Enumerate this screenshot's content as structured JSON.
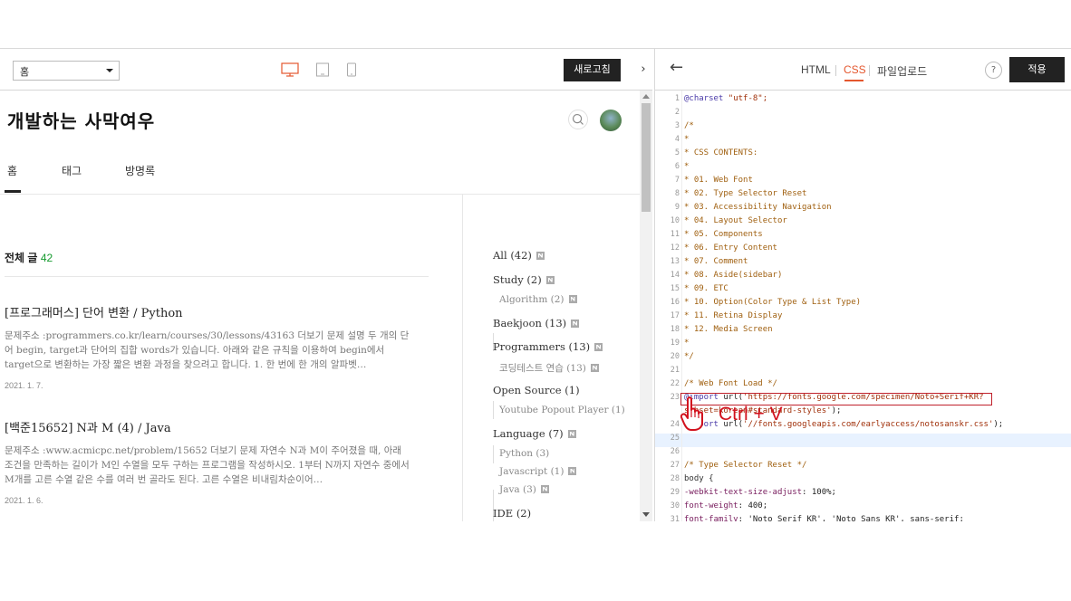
{
  "left_toolbar": {
    "select_value": "홈",
    "refresh_label": "새로고침",
    "collapse_arrow": "›"
  },
  "blog": {
    "title": "개발하는 사막여우",
    "nav": [
      {
        "label": "홈",
        "active": true
      },
      {
        "label": "태그",
        "active": false
      },
      {
        "label": "방명록",
        "active": false
      }
    ],
    "post_count_label": "전체 글",
    "post_count": "42",
    "posts": [
      {
        "title": "[프로그래머스] 단어 변환 / Python",
        "snippet": "문제주소 :programmers.co.kr/learn/courses/30/lessons/43163 더보기 문제 설명 두 개의 단어 begin, target과 단어의 집합 words가 있습니다. 아래와 같은 규칙을 이용하여 begin에서 target으로 변환하는 가장 짧은 변환 과정을 찾으려고 합니다. 1. 한 번에 한 개의 알파벳…",
        "date": "2021. 1. 7."
      },
      {
        "title": "[백준15652] N과 M (4) / Java",
        "snippet": "문제주소 :www.acmicpc.net/problem/15652 더보기 문제 자연수 N과 M이 주어졌을 때, 아래 조건을 만족하는 길이가 M인 수열을 모두 구하는 프로그램을 작성하시오. 1부터 N까지 자연수 중에서 M개를 고른 수열 같은 수를 여러 번 골라도 된다. 고른 수열은 비내림차순이어…",
        "date": "2021. 1. 6."
      }
    ],
    "categories": [
      {
        "label": "All (42)",
        "level": "main",
        "badge": true
      },
      {
        "label": "Study (2)",
        "level": "main",
        "badge": true
      },
      {
        "label": "Algorithm (2)",
        "level": "sub",
        "badge": true
      },
      {
        "label": "Baekjoon (13)",
        "level": "main",
        "badge": true
      },
      {
        "label": "Programmers (13)",
        "level": "main",
        "badge": true
      },
      {
        "label": "코딩테스트 연습 (13)",
        "level": "sub",
        "badge": true
      },
      {
        "label": "Open Source (1)",
        "level": "main",
        "badge": false
      },
      {
        "label": "Youtube Popout Player (1)",
        "level": "sub",
        "badge": false
      },
      {
        "label": "Language (7)",
        "level": "main",
        "badge": true
      },
      {
        "label": "Python (3)",
        "level": "sub",
        "badge": false
      },
      {
        "label": "Javascript (1)",
        "level": "sub",
        "badge": true
      },
      {
        "label": "Java (3)",
        "level": "sub",
        "badge": true
      },
      {
        "label": "IDE (2)",
        "level": "main",
        "badge": false
      }
    ]
  },
  "editor": {
    "back_arrow": "←",
    "tabs": [
      {
        "label": "HTML",
        "active": false
      },
      {
        "label": "CSS",
        "active": true
      },
      {
        "label": "파일업로드",
        "active": false
      }
    ],
    "help_label": "?",
    "apply_label": "적용",
    "lines": [
      {
        "n": "1",
        "text": "@charset \"utf-8\";",
        "type": "at"
      },
      {
        "n": "2",
        "text": "",
        "type": "plain"
      },
      {
        "n": "3",
        "text": "/*",
        "type": "com"
      },
      {
        "n": "4",
        "text": " *",
        "type": "com"
      },
      {
        "n": "5",
        "text": " * CSS CONTENTS:",
        "type": "com"
      },
      {
        "n": "6",
        "text": " *",
        "type": "com"
      },
      {
        "n": "7",
        "text": " * 01. Web Font",
        "type": "com"
      },
      {
        "n": "8",
        "text": " * 02. Type Selector Reset",
        "type": "com"
      },
      {
        "n": "9",
        "text": " * 03. Accessibility Navigation",
        "type": "com"
      },
      {
        "n": "10",
        "text": " * 04. Layout Selector",
        "type": "com"
      },
      {
        "n": "11",
        "text": " * 05. Components",
        "type": "com"
      },
      {
        "n": "12",
        "text": " * 06. Entry Content",
        "type": "com"
      },
      {
        "n": "13",
        "text": " * 07. Comment",
        "type": "com"
      },
      {
        "n": "14",
        "text": " * 08. Aside(sidebar)",
        "type": "com"
      },
      {
        "n": "15",
        "text": " * 09. ETC",
        "type": "com"
      },
      {
        "n": "16",
        "text": " * 10. Option(Color Type & List Type)",
        "type": "com"
      },
      {
        "n": "17",
        "text": " * 11. Retina Display",
        "type": "com"
      },
      {
        "n": "18",
        "text": " * 12. Media Screen",
        "type": "com"
      },
      {
        "n": "19",
        "text": " *",
        "type": "com"
      },
      {
        "n": "20",
        "text": " */",
        "type": "com"
      },
      {
        "n": "21",
        "text": "",
        "type": "plain"
      },
      {
        "n": "22",
        "text": "/* Web Font Load */",
        "type": "com"
      },
      {
        "n": "23",
        "text": "@import url('https://fonts.google.com/specimen/Noto+Serif+KR?",
        "type": "import"
      },
      {
        "n": "",
        "text": "subset=korean#standard-styles');",
        "type": "import-cont"
      },
      {
        "n": "24",
        "text": "@import url('//fonts.googleapis.com/earlyaccess/notosanskr.css');",
        "type": "import"
      },
      {
        "n": "25",
        "text": "",
        "type": "plain"
      },
      {
        "n": "26",
        "text": "",
        "type": "plain"
      },
      {
        "n": "27",
        "text": "/* Type Selector Reset */",
        "type": "com"
      },
      {
        "n": "28",
        "text": "body {",
        "type": "plain"
      },
      {
        "n": "29",
        "text": "  -webkit-text-size-adjust: 100%;",
        "type": "prop"
      },
      {
        "n": "30",
        "text": "  font-weight: 400;",
        "type": "prop"
      },
      {
        "n": "31",
        "text": "  font-family: 'Noto Serif KR', 'Noto Sans KR', sans-serif;",
        "type": "prop"
      }
    ],
    "annotation": "Ctrl + V"
  },
  "colors": {
    "accent": "#e4572e",
    "count_green": "#159a2e",
    "annotation_red": "#d2121e"
  }
}
